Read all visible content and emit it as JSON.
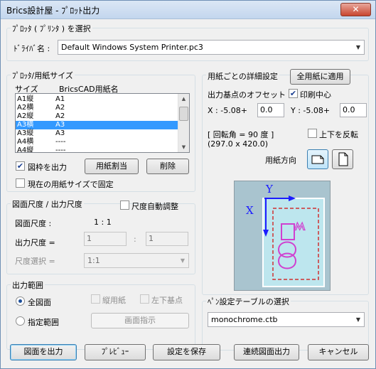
{
  "window": {
    "title": "Brics設計屋 - ﾌﾟﾛｯﾄ出力",
    "close_symbol": "✕"
  },
  "plotter": {
    "group_title": "ﾌﾟﾛｯﾀ ( ﾌﾟﾘﾝﾀ ) を選択",
    "driver_label": "ﾄﾞﾗｲﾊﾞ名 :",
    "driver_value": "Default Windows System Printer.pc3"
  },
  "paper": {
    "group_title": "ﾌﾟﾛｯﾀ/用紙サイズ",
    "col_size": "サイズ",
    "col_cad": "BricsCAD用紙名",
    "rows": [
      {
        "size": "A1縦",
        "cad": "A1"
      },
      {
        "size": "A2横",
        "cad": "A2"
      },
      {
        "size": "A2縦",
        "cad": "A2"
      },
      {
        "size": "A3横",
        "cad": "A3"
      },
      {
        "size": "A3縦",
        "cad": "A3"
      },
      {
        "size": "A4横",
        "cad": "----"
      },
      {
        "size": "A4縦",
        "cad": "----"
      }
    ],
    "selected_index": 3,
    "frame_label": "図枠を出力",
    "frame_checked": true,
    "assign_button": "用紙割当",
    "delete_button": "削除",
    "fix_label": "現在の用紙サイズで固定",
    "fix_checked": false
  },
  "scale": {
    "group_title": "図面尺度 / 出力尺度",
    "auto_label": "尺度自動調整",
    "auto_checked": false,
    "drawing_label": "図面尺度 :",
    "drawing_value": "1 : 1",
    "output_label": "出力尺度 =",
    "output_left": "1",
    "output_sep": ":",
    "output_right": "1",
    "select_label": "尺度選択 =",
    "select_value": "1:1"
  },
  "range": {
    "group_title": "出力範囲",
    "all_label": "全図面",
    "specified_label": "指定範囲",
    "selected": "all",
    "vertical_label": "縦用紙",
    "lower_left_label": "左下基点",
    "screen_button": "画面指示"
  },
  "details": {
    "group_title": "用紙ごとの詳細設定",
    "apply_all_button": "全用紙に適用",
    "offset_label": "出力基点のオフセット :",
    "center_label": "印刷中心",
    "center_checked": true,
    "x_label": "X : -5.08+",
    "x_value": "0.0",
    "y_label": "Y : -5.08+",
    "y_value": "0.0",
    "rotation_text": "[ 回転角 =     90  度 ]",
    "size_text": "(297.0 x 420.0)",
    "flip_label": "上下を反転",
    "flip_checked": false,
    "orientation_label": "用紙方向",
    "preview_x": "X",
    "preview_y": "Y"
  },
  "pen": {
    "group_title": "ﾍﾟﾝ設定テーブルの選択",
    "value": "monochrome.ctb"
  },
  "footer": {
    "plot_button": "図面を出力",
    "preview_button": "ﾌﾟﾚﾋﾞｭｰ",
    "save_button": "設定を保存",
    "batch_button": "連続図面出力",
    "cancel_button": "キャンセル"
  },
  "colors": {
    "selection": "#3399ff",
    "preview_bg": "#a9c4cf",
    "paper_fill": "#bde6ee",
    "axis_blue": "#1b1bff",
    "frame_red": "#d03030",
    "glyph_magenta": "#d040d0"
  }
}
